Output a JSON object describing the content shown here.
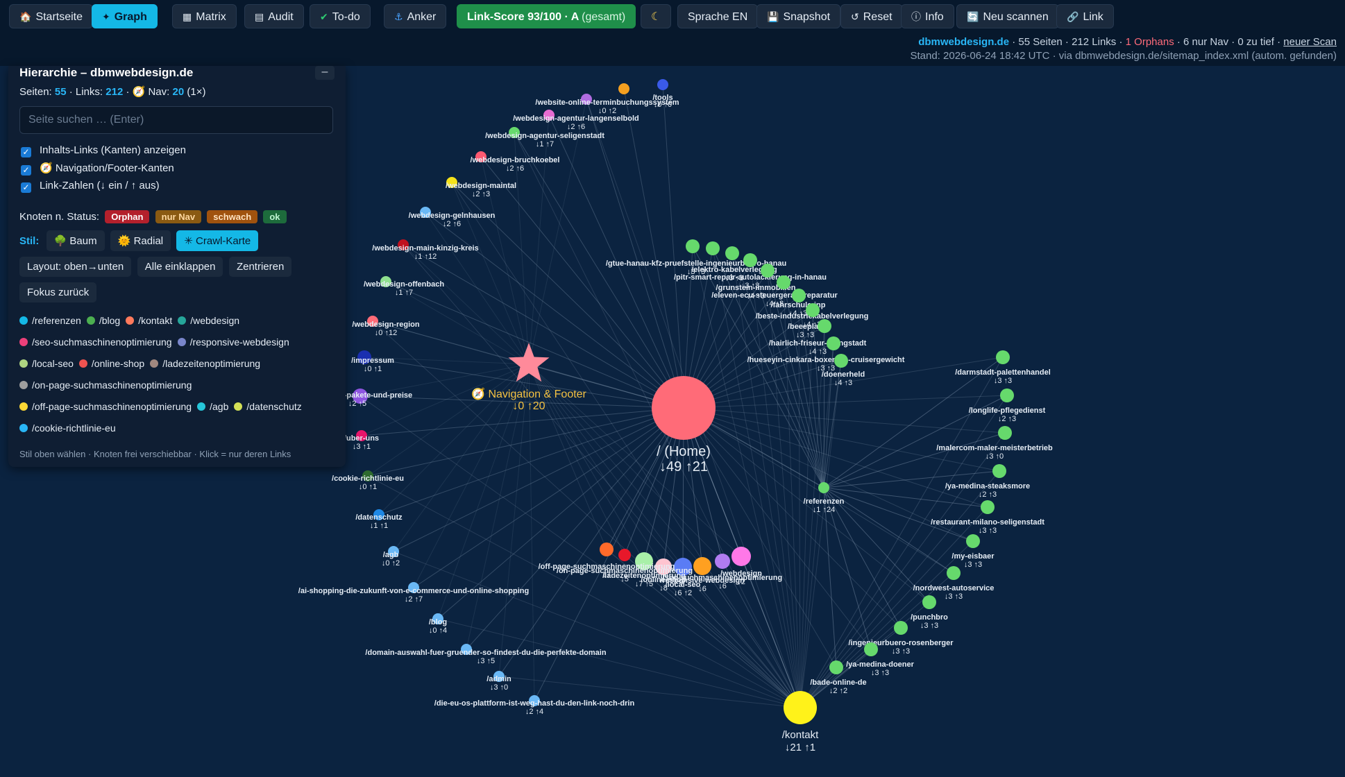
{
  "toolbar": {
    "buttons": [
      {
        "icon": "🏠",
        "label": "Startseite"
      },
      {
        "icon": "✦",
        "label": "Graph"
      },
      {
        "icon": "▦",
        "label": "Matrix"
      },
      {
        "icon": "▤",
        "label": "Audit"
      },
      {
        "icon": "✔",
        "label": "To-do"
      },
      {
        "icon": "⚓",
        "label": "Anker"
      }
    ],
    "score_label": "Link-Score 93/100 · A",
    "score_suffix": "(gesamt)",
    "theme_icon": "☾",
    "language_label": "Sprache EN",
    "snapshot_label": "Snapshot",
    "reset_label": "Reset",
    "info_label": "Info",
    "rescan_label": "Neu scannen",
    "link_label": "Link"
  },
  "status": {
    "domain": "dbmwebdesign.de",
    "pages_text": "· 55 Seiten · 212 Links ·",
    "orphans_text": "1 Orphans",
    "rest_text": "· 6 nur Nav · 0 zu tief ·",
    "rescan_link": "neuer Scan",
    "timestamp": "Stand: 2026-06-24 18:42 UTC · via dbmwebdesign.de/sitemap_index.xml (autom. gefunden)"
  },
  "panel": {
    "title": "Hierarchie – dbmwebdesign.de",
    "collapse": "–",
    "pages_label": "Seiten:",
    "pages": "55",
    "links_label": "· Links:",
    "links": "212",
    "nav_label": "· 🧭 Nav:",
    "nav": "20",
    "nav_suffix": "(1×)",
    "search_placeholder": "Seite suchen … (Enter)",
    "checkboxes": [
      "Inhalts-Links (Kanten) anzeigen",
      "🧭 Navigation/Footer-Kanten",
      "Link-Zahlen (↓ ein / ↑ aus)"
    ],
    "status_label": "Knoten n. Status:",
    "status_badges": [
      {
        "label": "Orphan",
        "bg": "#b3202c",
        "fg": "#ffffff"
      },
      {
        "label": "nur Nav",
        "bg": "#8a5a12",
        "fg": "#ffd9a0"
      },
      {
        "label": "schwach",
        "bg": "#a0520e",
        "fg": "#ffe2c0"
      },
      {
        "label": "ok",
        "bg": "#1d6b3c",
        "fg": "#bff5d2"
      }
    ],
    "style_label": "Stil:",
    "styles": [
      {
        "icon": "🌳",
        "label": "Baum"
      },
      {
        "icon": "🌞",
        "label": "Radial"
      },
      {
        "icon": "✳",
        "label": "Crawl-Karte"
      }
    ],
    "buttons1": [
      "Layout: oben→unten",
      "Alle einklappen",
      "Zentrieren"
    ],
    "buttons2": [
      "Fokus zurück"
    ],
    "legend": [
      {
        "label": "/referenzen",
        "color": "#14b8e6"
      },
      {
        "label": "/blog",
        "color": "#4caf50"
      },
      {
        "label": "/kontakt",
        "color": "#ff7a5c"
      },
      {
        "label": "/webdesign",
        "color": "#26a69a"
      },
      {
        "label": "/seo-suchmaschinenoptimierung",
        "color": "#ec407a"
      },
      {
        "label": "/responsive-webdesign",
        "color": "#7986cb"
      },
      {
        "label": "/local-seo",
        "color": "#aed581"
      },
      {
        "label": "/online-shop",
        "color": "#ef5350"
      },
      {
        "label": "/ladezeitenoptimierung",
        "color": "#a1887f"
      },
      {
        "label": "/on-page-suchmaschinenoptimierung",
        "color": "#9e9e9e"
      },
      {
        "label": "/off-page-suchmaschinenoptimierung",
        "color": "#fdd835"
      },
      {
        "label": "/agb",
        "color": "#26c6da"
      },
      {
        "label": "/datenschutz",
        "color": "#d4e157"
      },
      {
        "label": "/cookie-richtlinie-eu",
        "color": "#29b6f6"
      }
    ],
    "hint": "Stil oben wählen · Knoten frei verschiebbar · Klick = nur deren Links"
  },
  "graph": {
    "home": {
      "label": "/ (Home)",
      "counts": "↓49 ↑21",
      "color": "#ff6b78"
    },
    "nav": {
      "label": "🧭 Navigation & Footer",
      "counts": "↓0 ↑20",
      "color": "#ff8a9a"
    },
    "kontakt": {
      "label": "/kontakt",
      "counts": "↓21 ↑1",
      "color": "#fff21a"
    },
    "left_nodes": [
      {
        "label": "/website-online-terminbuchungssystem",
        "counts": "↓0 ↑2",
        "color": "#b06ce0"
      },
      {
        "label": "/webdesign-agentur-langenselbold",
        "counts": "↓2 ↑6",
        "color": "#e66cd0"
      },
      {
        "label": "/webdesign-agentur-seligenstadt",
        "counts": "↓1 ↑7",
        "color": "#66d96c"
      },
      {
        "label": "/webdesign-bruchkoebel",
        "counts": "↓2 ↑6",
        "color": "#ff5a72"
      },
      {
        "label": "/webdesign-maintal",
        "counts": "↓2 ↑3",
        "color": "#f5e21a"
      },
      {
        "label": "/webdesign-gelnhausen",
        "counts": "↓2 ↑6",
        "color": "#6ab8f5"
      },
      {
        "label": "/webdesign-main-kinzig-kreis",
        "counts": "↓1 ↑12",
        "color": "#c0111f"
      },
      {
        "label": "/webdesign-offenbach",
        "counts": "↓1 ↑7",
        "color": "#8fe08f"
      },
      {
        "label": "/webdesign-region",
        "counts": "↓0 ↑12",
        "color": "#ff6b78"
      },
      {
        "label": "/impressum",
        "counts": "↓0 ↑1",
        "color": "#1a2fb0"
      },
      {
        "label": "/webdesign-pakete-und-preise",
        "counts": "↓2 ↑5",
        "color": "#8e55e0"
      },
      {
        "label": "/uber-uns",
        "counts": "↓3 ↑1",
        "color": "#e6156b"
      },
      {
        "label": "/cookie-richtlinie-eu",
        "counts": "↓0 ↑1",
        "color": "#2e6b2e"
      },
      {
        "label": "/datenschutz",
        "counts": "↓1 ↑1",
        "color": "#1e88e5"
      },
      {
        "label": "/agb",
        "counts": "↓0 ↑2",
        "color": "#6ab8f5"
      },
      {
        "label": "/ai-shopping-die-zukunft-von-e-commerce-und-online-shopping",
        "counts": "↓2 ↑7",
        "color": "#6ab8f5"
      },
      {
        "label": "/blog",
        "counts": "↓0 ↑4",
        "color": "#6ab8f5"
      },
      {
        "label": "/domain-auswahl-fuer-gruender-so-findest-du-die-perfekte-domain",
        "counts": "↓3 ↑5",
        "color": "#6ab8f5"
      },
      {
        "label": "/admin",
        "counts": "↓3 ↑0",
        "color": "#6ab8f5"
      },
      {
        "label": "/die-eu-os-plattform-ist-weg-hast-du-den-link-noch-drin",
        "counts": "↓2 ↑4",
        "color": "#6ab8f5"
      }
    ],
    "top_extra": [
      {
        "label": "/tools",
        "counts": "↓0 ↑0",
        "color": "#3a5ae8"
      },
      {
        "label": "",
        "counts": "",
        "color": "#f5a020"
      }
    ],
    "mid_nodes": [
      {
        "label": "/gtue-hanau-kfz-pruefstelle-ingenieurbuero-hanau",
        "counts": "↓3 ↑3",
        "color": "#66d96c"
      },
      {
        "label": "/elektro-kabelverlegung",
        "counts": "↓3 ↑3",
        "color": "#66d96c"
      },
      {
        "label": "/pitr-smart-repair-autolackierung-in-hanau",
        "counts": "↓3 ↑3",
        "color": "#66d96c"
      },
      {
        "label": "/grunstein-immobilien",
        "counts": "↓4 ↑3",
        "color": "#66d96c"
      },
      {
        "label": "/eleven-ecu-steuergeraet-reparatur",
        "counts": "↓4 ↑3",
        "color": "#66d96c"
      },
      {
        "label": "/fahrschule-inp",
        "counts": "↓4 ↑3",
        "color": "#66d96c"
      },
      {
        "label": "/beste-industriekabelverlegung",
        "counts": "↓4 ↑3",
        "color": "#66d96c"
      },
      {
        "label": "/beeeplay",
        "counts": "↓3 ↑3",
        "color": "#66d96c"
      },
      {
        "label": "/hairlich-friseur-pfungstadt",
        "counts": "↓4 ↑3",
        "color": "#66d96c"
      },
      {
        "label": "/hueseyin-cinkara-boxen-im-cruisergewicht",
        "counts": "↓3 ↑3",
        "color": "#66d96c"
      },
      {
        "label": "/doenerheld",
        "counts": "↓4 ↑3",
        "color": "#66d96c"
      }
    ],
    "right_nodes": [
      {
        "label": "/darmstadt-palettenhandel",
        "counts": "↓3 ↑3",
        "color": "#66d96c"
      },
      {
        "label": "/longlife-pflegedienst",
        "counts": "↓2 ↑3",
        "color": "#66d96c"
      },
      {
        "label": "/malercom-maler-meisterbetrieb",
        "counts": "↓3 ↑0",
        "color": "#66d96c"
      },
      {
        "label": "/ya-medina-steaksmore",
        "counts": "↓2 ↑3",
        "color": "#66d96c"
      },
      {
        "label": "/restaurant-milano-seligenstadt",
        "counts": "↓3 ↑3",
        "color": "#66d96c"
      },
      {
        "label": "/my-eisbaer",
        "counts": "↓3 ↑3",
        "color": "#66d96c"
      },
      {
        "label": "/nordwest-autoservice",
        "counts": "↓3 ↑3",
        "color": "#66d96c"
      },
      {
        "label": "/punchbro",
        "counts": "↓3 ↑3",
        "color": "#66d96c"
      },
      {
        "label": "/ingenieurbuero-rosenberger",
        "counts": "↓3 ↑3",
        "color": "#66d96c"
      },
      {
        "label": "/ya-medina-doener",
        "counts": "↓3 ↑3",
        "color": "#66d96c"
      },
      {
        "label": "/bade-online-de",
        "counts": "↓2 ↑2",
        "color": "#66d96c"
      }
    ],
    "referenzen": {
      "label": "/referenzen",
      "counts": "↓1 ↑24",
      "color": "#66d96c"
    },
    "bottom_nodes": [
      {
        "label": "/off-page-suchmaschinenoptimierung",
        "counts": "↓7",
        "color": "#ff6a2a"
      },
      {
        "label": "/on-page-suchmaschinenoptimierung",
        "counts": "↓5",
        "color": "#e8182a"
      },
      {
        "label": "/ladezeitenoptimierung",
        "counts": "↓7 ↑5",
        "color": "#a8f0a8"
      },
      {
        "label": "/online-shop",
        "counts": "↓8",
        "color": "#ffc4d0"
      },
      {
        "label": "/local-seo",
        "counts": "↓6 ↑2",
        "color": "#5a7cf5"
      },
      {
        "label": "/responsive-webdesign",
        "counts": "↓6",
        "color": "#ffa020"
      },
      {
        "label": "/seo-suchmaschinenoptimierung",
        "counts": "↓6",
        "color": "#b07cf0"
      },
      {
        "label": "/webdesign",
        "counts": "↓2",
        "color": "#ff78e8"
      }
    ]
  }
}
